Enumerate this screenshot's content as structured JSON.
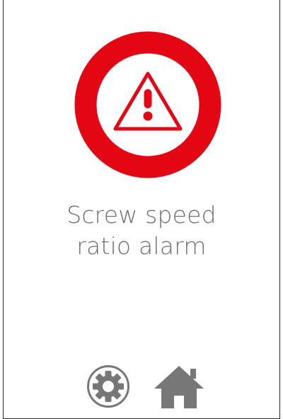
{
  "alarm": {
    "icon": "warning-triangle-icon",
    "message_line1": "Screw speed",
    "message_line2": "ratio alarm",
    "ring_color": "#e30613",
    "text_color": "#6f6f6f"
  },
  "footer": {
    "settings_icon": "gear-icon",
    "home_icon": "home-icon",
    "icon_color": "#777777"
  }
}
